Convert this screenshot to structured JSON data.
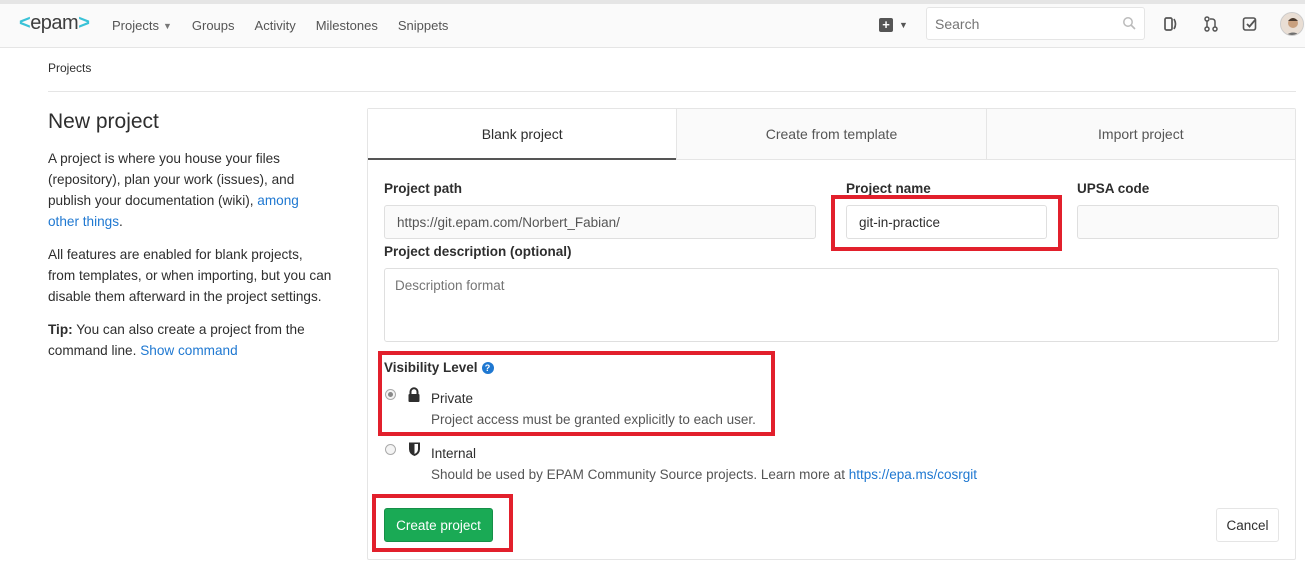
{
  "header": {
    "logo_text": "epam",
    "nav": {
      "projects": "Projects",
      "groups": "Groups",
      "activity": "Activity",
      "milestones": "Milestones",
      "snippets": "Snippets"
    },
    "search_placeholder": "Search"
  },
  "breadcrumb": {
    "current": "Projects"
  },
  "sidebar": {
    "title": "New project",
    "p1_text": "A project is where you house your files (repository), plan your work (issues), and publish your documentation (wiki),",
    "p1_link": "among other things",
    "p1_end": ".",
    "p2": "All features are enabled for blank projects, from templates, or when importing, but you can disable them afterward in the project settings.",
    "tip_label": "Tip:",
    "tip_text": "You can also create a project from the command line.",
    "tip_link": "Show command"
  },
  "tabs": {
    "blank": "Blank project",
    "template": "Create from template",
    "import": "Import project"
  },
  "form": {
    "path_label": "Project path",
    "path_value": "https://git.epam.com/Norbert_Fabian/",
    "name_label": "Project name",
    "name_value": "git-in-practice",
    "upsa_label": "UPSA code",
    "upsa_value": "",
    "desc_label": "Project description (optional)",
    "desc_placeholder": "Description format",
    "visibility_label": "Visibility Level",
    "private_title": "Private",
    "private_desc": "Project access must be granted explicitly to each user.",
    "internal_title": "Internal",
    "internal_desc": "Should be used by EPAM Community Source projects. Learn more at",
    "internal_link": "https://epa.ms/cosrgit",
    "selected_visibility": "Private"
  },
  "buttons": {
    "create": "Create project",
    "cancel": "Cancel"
  },
  "colors": {
    "highlight": "#e2202c",
    "primary_button": "#1aaa55",
    "link": "#1f78d1"
  }
}
